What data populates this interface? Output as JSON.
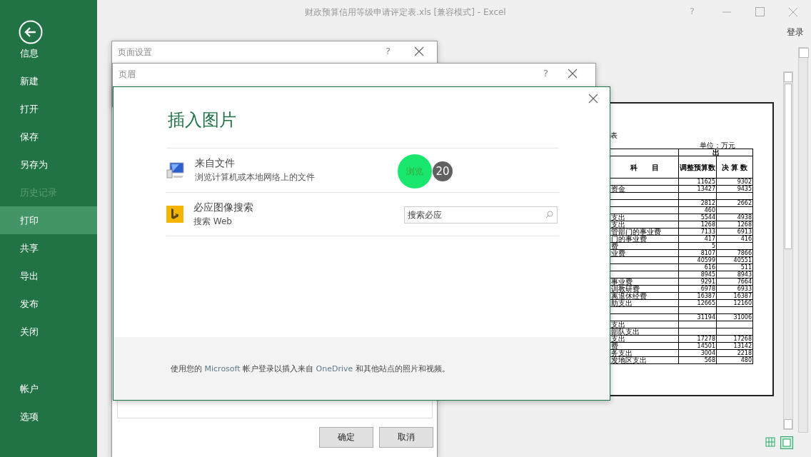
{
  "window": {
    "title": "财政预算信用等级申请评定表.xls  [兼容模式] - Excel",
    "help": "?"
  },
  "sign_in": "登录",
  "backstage": {
    "items": [
      {
        "label": "信息",
        "selected": false,
        "disabled": false
      },
      {
        "label": "新建",
        "selected": false,
        "disabled": false
      },
      {
        "label": "打开",
        "selected": false,
        "disabled": false
      },
      {
        "label": "保存",
        "selected": false,
        "disabled": false
      },
      {
        "label": "另存为",
        "selected": false,
        "disabled": false
      },
      {
        "label": "历史记录",
        "selected": false,
        "disabled": true
      },
      {
        "label": "打印",
        "selected": true,
        "disabled": false
      },
      {
        "label": "共享",
        "selected": false,
        "disabled": false
      },
      {
        "label": "导出",
        "selected": false,
        "disabled": false
      },
      {
        "label": "发布",
        "selected": false,
        "disabled": false
      },
      {
        "label": "关闭",
        "selected": false,
        "disabled": false
      },
      {
        "label": "帐户",
        "selected": false,
        "disabled": false
      },
      {
        "label": "选项",
        "selected": false,
        "disabled": false
      }
    ]
  },
  "preview": {
    "title_fragment": "表",
    "unit": "单位：万元",
    "group_header": "出",
    "columns": [
      "科　　目",
      "调整预算数",
      "决 算 数"
    ],
    "rows": [
      {
        "label": "",
        "budget": "11625",
        "final": "9302"
      },
      {
        "label": "资金",
        "budget": "13427",
        "final": "9435"
      },
      {
        "label": "",
        "budget": "",
        "final": ""
      },
      {
        "label": "",
        "budget": "2812",
        "final": "2662"
      },
      {
        "label": "",
        "budget": "460",
        "final": ""
      },
      {
        "label": "支出",
        "budget": "5544",
        "final": "4938"
      },
      {
        "label": "支出",
        "budget": "1268",
        "final": "1268"
      },
      {
        "label": "管部门的事业费",
        "budget": "7133",
        "final": "6913"
      },
      {
        "label": "门的事业费",
        "budget": "417",
        "final": "416"
      },
      {
        "label": "费",
        "budget": "5",
        "final": ""
      },
      {
        "label": "业费",
        "budget": "8107",
        "final": "7866"
      },
      {
        "label": "",
        "budget": "40599",
        "final": "40551"
      },
      {
        "label": "",
        "budget": "616",
        "final": "511"
      },
      {
        "label": "",
        "budget": "8945",
        "final": "8943"
      },
      {
        "label": "事业费",
        "budget": "9291",
        "final": "7664"
      },
      {
        "label": "训教研费",
        "budget": "6978",
        "final": "6933"
      },
      {
        "label": "离退休经费",
        "budget": "16387",
        "final": "16387"
      },
      {
        "label": "助支出",
        "budget": "12665",
        "final": "12160"
      },
      {
        "label": "",
        "budget": "",
        "final": ""
      },
      {
        "label": "",
        "budget": "31194",
        "final": "31006"
      },
      {
        "label": "支出",
        "budget": "",
        "final": ""
      },
      {
        "label": "部队支出",
        "budget": "",
        "final": ""
      },
      {
        "label": "支出",
        "budget": "17278",
        "final": "17268"
      },
      {
        "label": "费",
        "budget": "14501",
        "final": "13142"
      },
      {
        "label": "务支出",
        "budget": "3004",
        "final": "2218"
      },
      {
        "label": "发地区支出",
        "budget": "568",
        "final": "480"
      }
    ]
  },
  "page_setup": {
    "title": "页面设置",
    "help": "?",
    "buttons": [
      "确定",
      "取消"
    ]
  },
  "header_dialog": {
    "title": "页眉",
    "help": "?"
  },
  "insert_picture": {
    "title": "插入图片",
    "sources": [
      {
        "kind": "file",
        "title": "来自文件",
        "subtitle": "浏览计算机或本地网络上的文件",
        "action": "浏览"
      },
      {
        "kind": "bing",
        "title": "必应图像搜索",
        "subtitle": "搜索 Web",
        "placeholder": "搜索必应"
      }
    ],
    "note": [
      {
        "text": "使用您的 ",
        "brand": false
      },
      {
        "text": "Microsoft",
        "brand": true
      },
      {
        "text": " 帐户登录以插入来自 ",
        "brand": false
      },
      {
        "text": "OneDrive",
        "brand": true
      },
      {
        "text": " 和其他站点的照片和视频。",
        "brand": false
      }
    ]
  },
  "step_badge": "20"
}
